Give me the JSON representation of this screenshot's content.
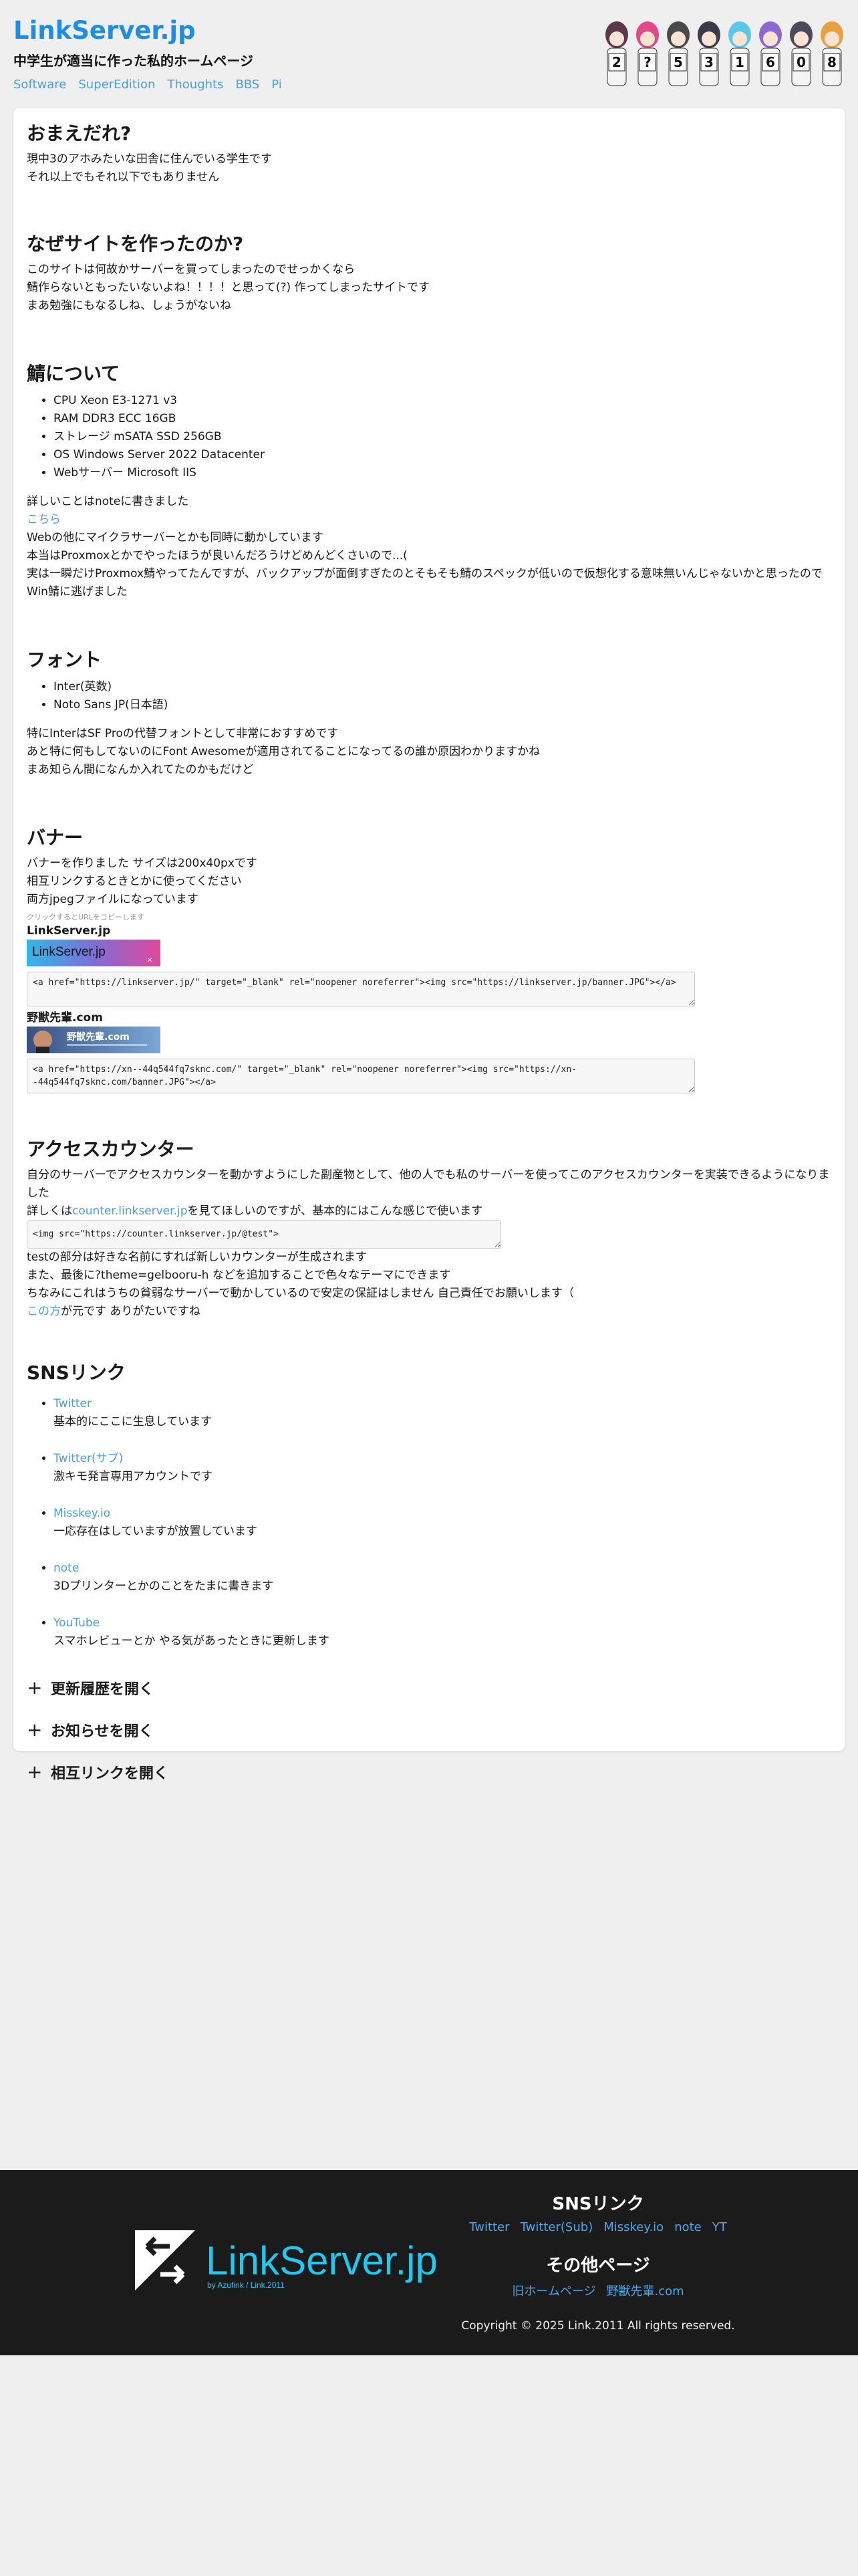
{
  "header": {
    "title": "LinkServer.jp",
    "subtitle": "中学生が適当に作った私的ホームページ",
    "nav": [
      "Software",
      "SuperEdition",
      "Thoughts",
      "BBS",
      "Pi"
    ],
    "char_numbers": [
      "2",
      "?",
      "5",
      "3",
      "1",
      "6",
      "0",
      "8"
    ]
  },
  "about": {
    "heading": "おまえだれ?",
    "lines": [
      "現中3のアホみたいな田舎に住んでいる学生です",
      "それ以上でもそれ以下でもありません"
    ]
  },
  "why": {
    "heading": "なぜサイトを作ったのか?",
    "lines": [
      "このサイトは何故かサーバーを買ってしまったのでせっかくなら",
      "鯖作らないともったいないよね！！！！と思って(?) 作ってしまったサイトです",
      "まあ勉強にもなるしね、しょうがないね"
    ]
  },
  "server": {
    "heading": "鯖について",
    "specs": [
      "CPU Xeon E3-1271 v3",
      "RAM DDR3 ECC 16GB",
      "ストレージ mSATA SSD 256GB",
      "OS Windows Server 2022 Datacenter",
      "Webサーバー Microsoft IIS"
    ],
    "detail": "詳しいことはnoteに書きました",
    "link": "こちら",
    "lines": [
      "Webの他にマイクラサーバーとかも同時に動かしています",
      "本当はProxmoxとかでやったほうが良いんだろうけどめんどくさいので...(",
      "実は一瞬だけProxmox鯖やってたんですが、バックアップが面倒すぎたのとそもそも鯖のスペックが低いので仮想化する意味無いんじゃないかと思ったのでWin鯖に逃げました"
    ]
  },
  "font": {
    "heading": "フォント",
    "items": [
      "Inter(英数)",
      "Noto Sans JP(日本語)"
    ],
    "lines": [
      "特にInterはSF Proの代替フォントとして非常におすすめです",
      "あと特に何もしてないのにFont Awesomeが適用されてることになってるの誰か原因わかりますかね",
      "まあ知らん間になんか入れてたのかもだけど"
    ]
  },
  "banner": {
    "heading": "バナー",
    "lines": [
      "バナーを作りました サイズは200x40pxです",
      "相互リンクするときとかに使ってください",
      "両方jpegファイルになっています"
    ],
    "note": "クリックするとURLをコピーします",
    "items": [
      {
        "name": "LinkServer.jp",
        "img_text": "LinkServer.jp",
        "code": "<a href=\"https://linkserver.jp/\" target=\"_blank\" rel=\"noopener noreferrer\"><img src=\"https://linkserver.jp/banner.JPG\"></a>"
      },
      {
        "name": "野獣先輩.com",
        "img_text": "野獣先輩.com",
        "code": "<a href=\"https://xn--44q544fq7sknc.com/\" target=\"_blank\" rel=\"noopener noreferrer\"><img src=\"https://xn--44q544fq7sknc.com/banner.JPG\"></a>"
      }
    ]
  },
  "counter": {
    "heading": "アクセスカウンター",
    "line1": "自分のサーバーでアクセスカウンターを動かすようにした副産物として、他の人でも私のサーバーを使ってこのアクセスカウンターを実装できるようになりました",
    "line2_pre": "詳しくは",
    "line2_link": "counter.linkserver.jp",
    "line2_post": "を見てほしいのですが、基本的にはこんな感じで使います",
    "code": "<img src=\"https://counter.linkserver.jp/@test\">",
    "lines": [
      "testの部分は好きな名前にすれば新しいカウンターが生成されます",
      "また、最後に?theme=gelbooru-h などを追加することで色々なテーマにできます",
      "ちなみにこれはうちの貧弱なサーバーで動かしているので安定の保証はしません 自己責任でお願いします（"
    ],
    "last_link": "この方",
    "last_post": "が元です ありがたいですね"
  },
  "sns": {
    "heading": "SNSリンク",
    "items": [
      {
        "label": "Twitter",
        "desc": "基本的にここに生息しています"
      },
      {
        "label": "Twitter(サブ)",
        "desc": "激キモ発言専用アカウントです"
      },
      {
        "label": "Misskey.io",
        "desc": "一応存在はしていますが放置しています"
      },
      {
        "label": "note",
        "desc": "3Dプリンターとかのことをたまに書きます"
      },
      {
        "label": "YouTube",
        "desc": "スマホレビューとか やる気があったときに更新します"
      }
    ]
  },
  "accordion": [
    "更新履歴を開く",
    "お知らせを開く",
    "相互リンクを開く"
  ],
  "footer": {
    "logo_text": "LinkServer.jp",
    "logo_sub": "by Azufink / Link.2011",
    "sns_heading": "SNSリンク",
    "sns_links": [
      "Twitter",
      "Twitter(Sub)",
      "Misskey.io",
      "note",
      "YT"
    ],
    "other_heading": "その他ページ",
    "other_links": [
      "旧ホームページ",
      "野獣先輩.com"
    ],
    "copyright": "Copyright © 2025 Link.2011 All rights reserved."
  }
}
